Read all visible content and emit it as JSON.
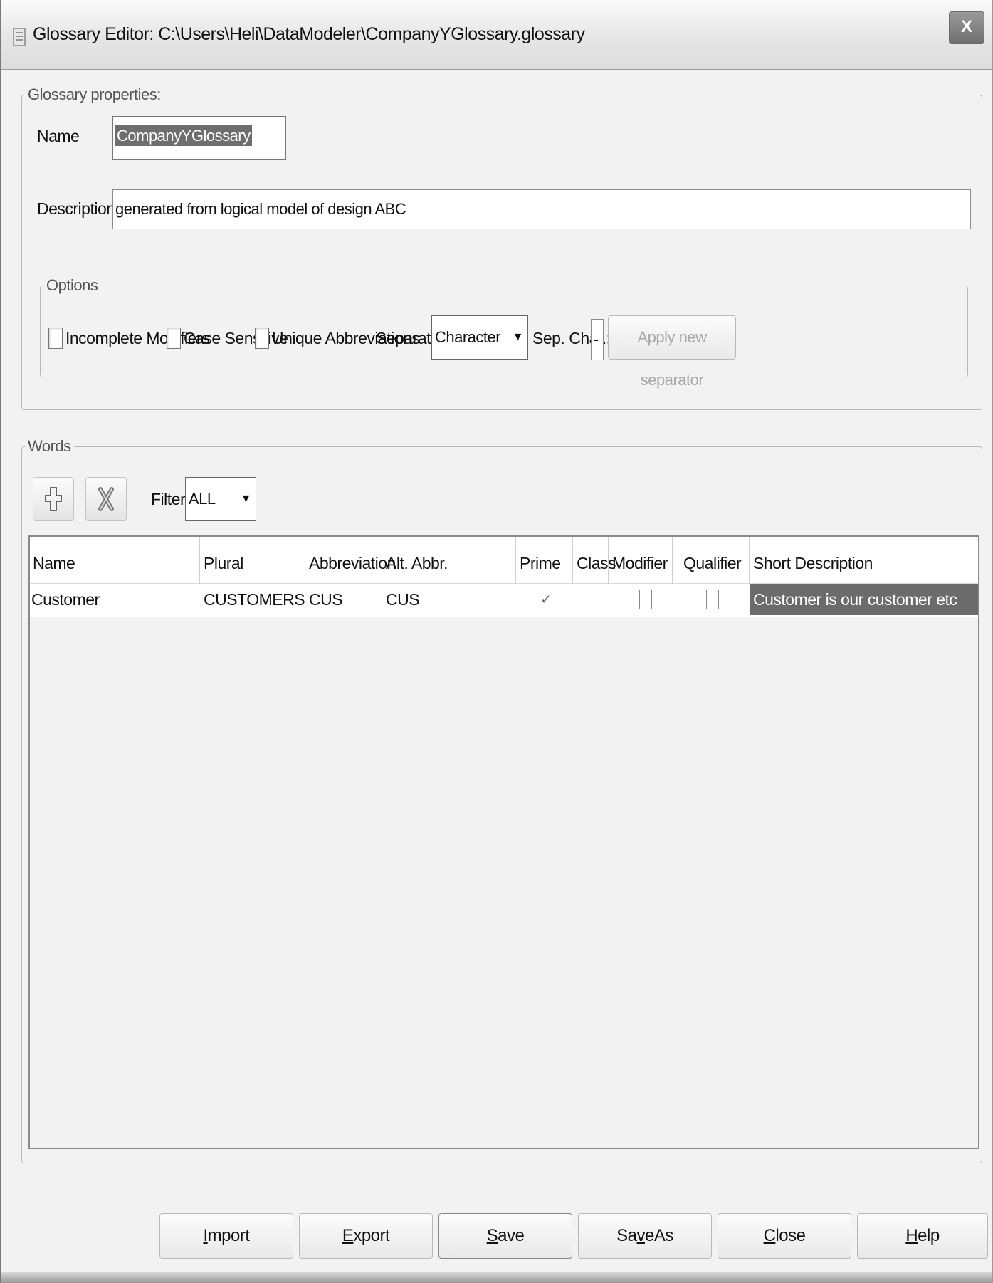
{
  "window": {
    "title": "Glossary Editor: C:\\Users\\Heli\\DataModeler\\CompanyYGlossary.glossary",
    "close_label": "X"
  },
  "properties": {
    "legend": "Glossary properties:",
    "name_label": "Name",
    "name_value": "CompanyYGlossary",
    "description_label": "Description",
    "description_value": "generated from logical model of design ABC",
    "options": {
      "legend": "Options",
      "incomplete_modifiers": {
        "label": "Incomplete Modifiers",
        "checked": false
      },
      "case_sensitive": {
        "label": "Case Sensitive",
        "checked": false
      },
      "unique_abbreviations": {
        "label": "Unique Abbreviations",
        "checked": false
      },
      "separator_label": "Separator:",
      "separator_value": "Character",
      "sep_char_label": "Sep. Char.:",
      "sep_char_value": "-",
      "apply_button": "Apply new separator"
    }
  },
  "words": {
    "legend": "Words",
    "filter_label": "Filter:",
    "filter_value": "ALL",
    "columns": [
      "Name",
      "Plural",
      "Abbreviation",
      "Alt. Abbr.",
      "Prime",
      "Class",
      "Modifier",
      "Qualifier",
      "Short Description"
    ],
    "rows": [
      {
        "name": "Customer",
        "plural": "CUSTOMERS",
        "abbreviation": "CUS",
        "alt_abbr": "CUS",
        "prime": true,
        "class": false,
        "modifier": false,
        "qualifier": false,
        "short_description": "Customer is our customer etc"
      }
    ]
  },
  "footer": {
    "buttons": [
      {
        "pre": "",
        "u": "I",
        "post": "mport"
      },
      {
        "pre": "",
        "u": "E",
        "post": "xport"
      },
      {
        "pre": "",
        "u": "S",
        "post": "ave"
      },
      {
        "pre": "Sa",
        "u": "v",
        "post": "eAs"
      },
      {
        "pre": "",
        "u": "C",
        "post": "lose"
      },
      {
        "pre": "",
        "u": "H",
        "post": "elp"
      }
    ]
  }
}
